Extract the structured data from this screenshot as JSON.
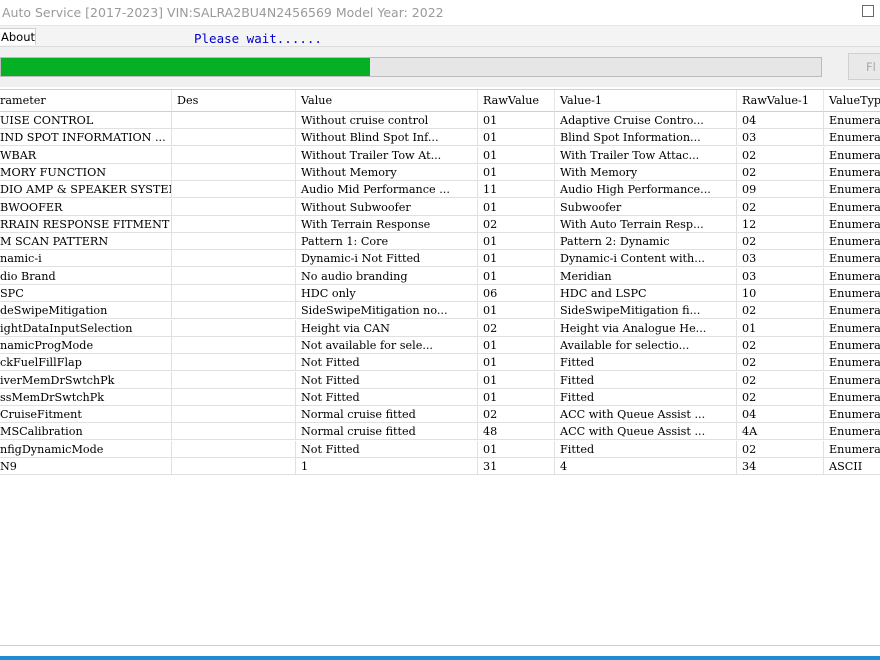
{
  "window": {
    "title": "Auto Service [2017-2023]   VIN:SALRA2BU4N2456569  Model Year: 2022"
  },
  "menu": {
    "about_label": "About"
  },
  "status": {
    "text": "Please wait......"
  },
  "progress": {
    "value_percent": 45
  },
  "toolbar": {
    "flash_label": "Fl"
  },
  "table": {
    "columns": [
      "rameter",
      "Des",
      "Value",
      "RawValue",
      "Value-1",
      "RawValue-1",
      "ValueTyp"
    ],
    "rows": [
      [
        "UISE CONTROL",
        "",
        "Without cruise control",
        "01",
        "Adaptive Cruise Contro...",
        "04",
        "Enumerat"
      ],
      [
        "IND SPOT INFORMATION ...",
        "",
        "Without Blind Spot Inf...",
        "01",
        "Blind Spot Information...",
        "03",
        "Enumerat"
      ],
      [
        "WBAR",
        "",
        "Without Trailer Tow At...",
        "01",
        "With Trailer Tow Attac...",
        "02",
        "Enumerat"
      ],
      [
        "MORY FUNCTION",
        "",
        "Without Memory",
        "01",
        "With Memory",
        "02",
        "Enumerat"
      ],
      [
        "DIO AMP & SPEAKER SYSTEM",
        "",
        "Audio Mid Performance ...",
        "11",
        "Audio High Performance...",
        "09",
        "Enumerat"
      ],
      [
        "BWOOFER",
        "",
        "Without Subwoofer",
        "01",
        "Subwoofer",
        "02",
        "Enumerat"
      ],
      [
        "RRAIN RESPONSE FITMENT",
        "",
        "With Terrain Response",
        "02",
        "With Auto Terrain Resp...",
        "12",
        "Enumerat"
      ],
      [
        "M SCAN PATTERN",
        "",
        "Pattern 1: Core",
        "01",
        "Pattern 2: Dynamic",
        "02",
        "Enumerat"
      ],
      [
        "namic-i",
        "",
        "Dynamic-i Not Fitted",
        "01",
        "Dynamic-i Content with...",
        "03",
        "Enumerat"
      ],
      [
        "dio Brand",
        "",
        "No audio branding",
        "01",
        "Meridian",
        "03",
        "Enumerat"
      ],
      [
        "SPC",
        "",
        "HDC only",
        "06",
        "HDC and LSPC",
        "10",
        "Enumerat"
      ],
      [
        "deSwipeMitigation",
        "",
        "SideSwipeMitigation no...",
        "01",
        "SideSwipeMitigation fi...",
        "02",
        "Enumerat"
      ],
      [
        "ightDataInputSelection",
        "",
        "Height via CAN",
        "02",
        "Height via Analogue He...",
        "01",
        "Enumerat"
      ],
      [
        "namicProgMode",
        "",
        "Not available for sele...",
        "01",
        "Available for selectio...",
        "02",
        "Enumerat"
      ],
      [
        "ckFuelFillFlap",
        "",
        "Not Fitted",
        "01",
        "Fitted",
        "02",
        "Enumerat"
      ],
      [
        "iverMemDrSwtchPk",
        "",
        "Not Fitted",
        "01",
        "Fitted",
        "02",
        "Enumerat"
      ],
      [
        "ssMemDrSwtchPk",
        "",
        "Not Fitted",
        "01",
        "Fitted",
        "02",
        "Enumerat"
      ],
      [
        "CruiseFitment",
        "",
        "Normal cruise fitted",
        "02",
        "ACC with Queue Assist ...",
        "04",
        "Enumerat"
      ],
      [
        "MSCalibration",
        "",
        "Normal cruise fitted",
        "48",
        "ACC with Queue Assist ...",
        "4A",
        "Enumerat"
      ],
      [
        "nfigDynamicMode",
        "",
        "Not Fitted",
        "01",
        "Fitted",
        "02",
        "Enumerat"
      ],
      [
        "N9",
        "",
        "1",
        "31",
        "4",
        "34",
        "ASCII"
      ]
    ]
  },
  "colors": {
    "progress_fill": "#06b025",
    "status_text": "#0000cc",
    "taskbar_accent": "#1f8dd6"
  }
}
